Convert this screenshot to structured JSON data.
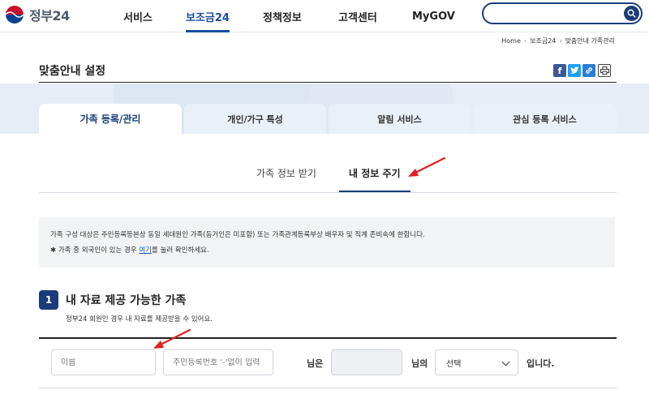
{
  "header": {
    "logo_text": "정부24",
    "nav": [
      "서비스",
      "보조금24",
      "정책정보",
      "고객센터",
      "MyGOV"
    ],
    "active_nav_index": 1,
    "search_placeholder": "",
    "search_icon": "search-icon"
  },
  "breadcrumb": {
    "items": [
      "Home",
      "보조금24",
      "맞춤안내 가족관리"
    ]
  },
  "page": {
    "title": "맞춤안내 설정",
    "share_icons": [
      "facebook-icon",
      "twitter-icon",
      "link-icon",
      "print-icon"
    ]
  },
  "tabs": {
    "items": [
      "가족 등록/관리",
      "개인/가구 특성",
      "알림 서비스",
      "관심 등록 서비스"
    ],
    "active_index": 0
  },
  "subtabs": {
    "items": [
      "가족 정보 받기",
      "내 정보 주기"
    ],
    "active_index": 1
  },
  "notice": {
    "line1": "가족 구성 대상은 주민등록등본상 동일 세대원인 가족(동거인은 미포함) 또는 가족관계등록부상 배우자 및 직계 존비속에 한합니다.",
    "line2_prefix": "✱ 가족 중 외국인이 있는 경우 ",
    "line2_link": "여기",
    "line2_suffix": "를 눌러 확인하세요."
  },
  "section": {
    "number": "1",
    "title": "내 자료 제공 가능한 가족",
    "subtitle": "정부24 회원인 경우 내 자료를 제공받을 수 있어요."
  },
  "form": {
    "name_placeholder": "이름",
    "rrn_placeholder": "주민등록번호 '-'없이 입력",
    "text_before": "님은",
    "text_middle": "님의",
    "select_value": "선택",
    "text_after": "입니다."
  },
  "colors": {
    "primary": "#1b3c7a",
    "accent": "#1a4fa0",
    "annotation_arrow": "#e02020"
  }
}
